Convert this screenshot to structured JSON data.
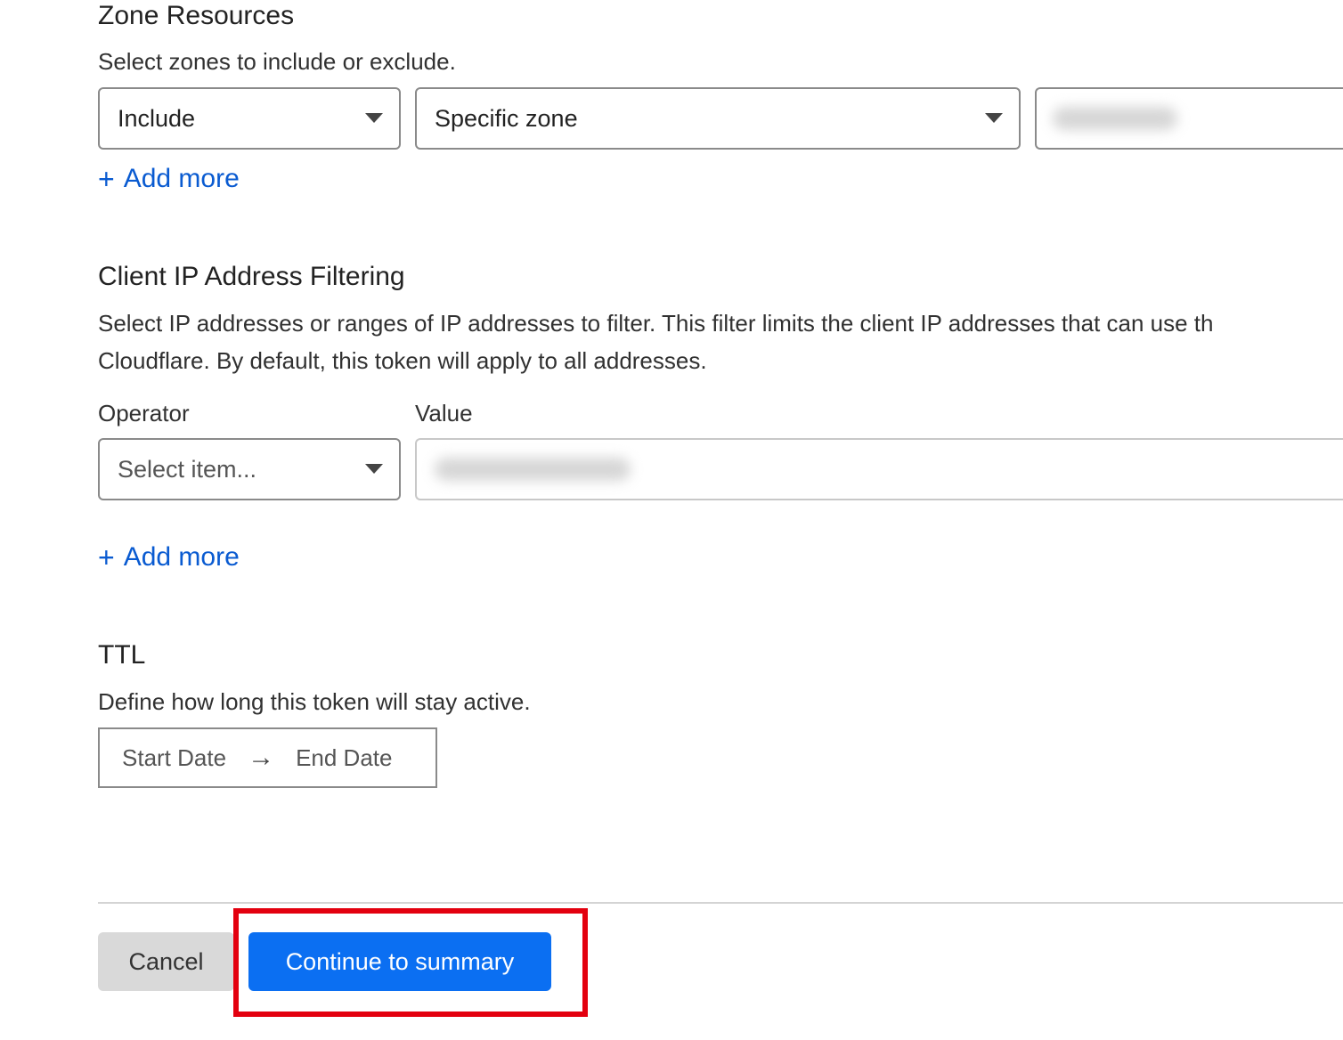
{
  "zone_resources": {
    "title": "Zone Resources",
    "description": "Select zones to include or exclude.",
    "include_select": {
      "value": "Include"
    },
    "zone_type_select": {
      "value": "Specific zone"
    },
    "add_more_label": "Add more"
  },
  "client_ip": {
    "title": "Client IP Address Filtering",
    "description_line1": "Select IP addresses or ranges of IP addresses to filter. This filter limits the client IP addresses that can use th",
    "description_line2": "Cloudflare. By default, this token will apply to all addresses.",
    "operator_label": "Operator",
    "value_label": "Value",
    "operator_select": {
      "placeholder": "Select item..."
    },
    "add_more_label": "Add more"
  },
  "ttl": {
    "title": "TTL",
    "description": "Define how long this token will stay active.",
    "start_date_placeholder": "Start Date",
    "end_date_placeholder": "End Date"
  },
  "footer": {
    "cancel_label": "Cancel",
    "continue_label": "Continue to summary"
  },
  "colors": {
    "link": "#0a5bd1",
    "primary_button": "#0b6ff2",
    "highlight_box": "#e3000f"
  }
}
